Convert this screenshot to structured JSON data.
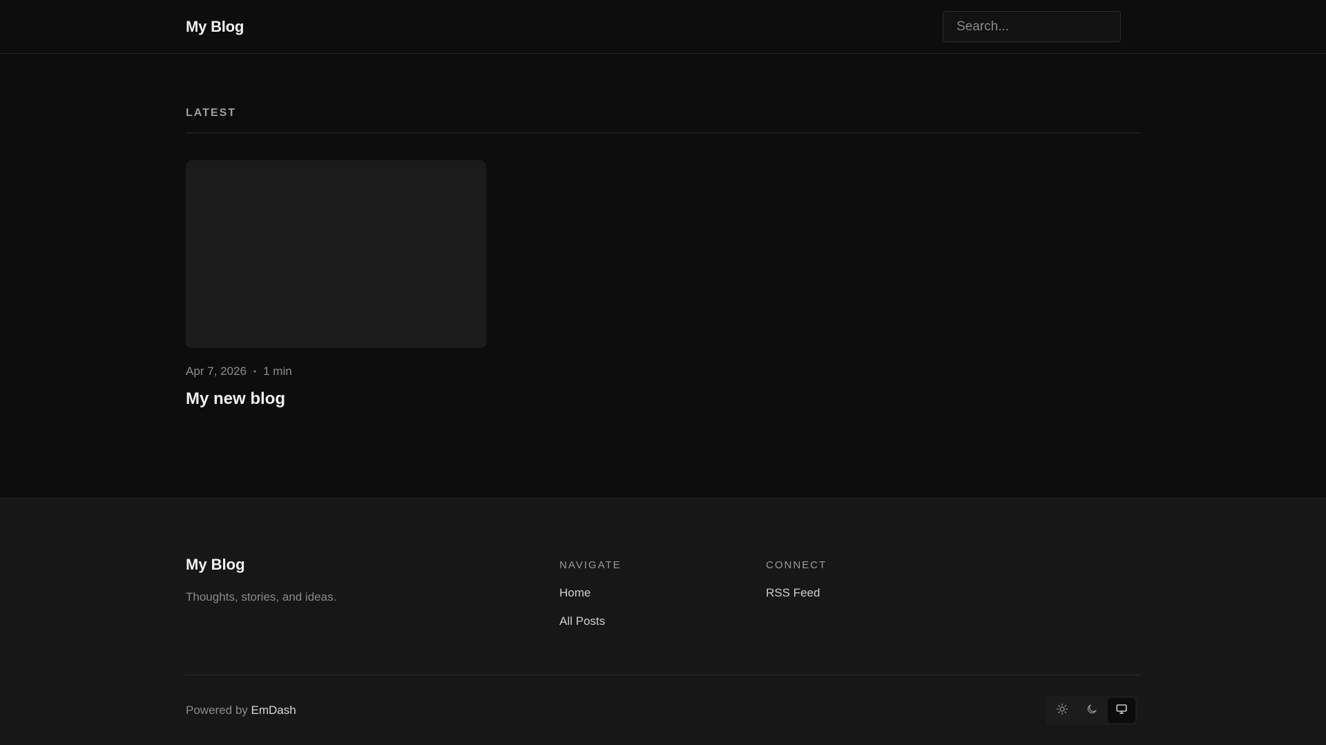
{
  "header": {
    "site_title": "My Blog",
    "search_placeholder": "Search..."
  },
  "main": {
    "section_label": "LATEST",
    "posts": [
      {
        "date": "Apr 7, 2026",
        "separator": "•",
        "read_time": "1 min",
        "title": "My new blog"
      }
    ]
  },
  "footer": {
    "site_title": "My Blog",
    "tagline": "Thoughts, stories, and ideas.",
    "navigate": {
      "heading": "NAVIGATE",
      "links": [
        "Home",
        "All Posts"
      ]
    },
    "connect": {
      "heading": "CONNECT",
      "links": [
        "RSS Feed"
      ]
    },
    "powered_by_prefix": "Powered by ",
    "powered_by_brand": "EmDash",
    "theme_toggle": {
      "options": [
        "sun-icon",
        "moon-icon",
        "monitor-icon"
      ],
      "active": "monitor-icon"
    }
  },
  "colors": {
    "background": "#0d0d0d",
    "footer_background": "#171717",
    "card_placeholder": "#1b1b1b",
    "text_primary": "#f0f0f0",
    "text_muted": "#8a8a8a"
  }
}
